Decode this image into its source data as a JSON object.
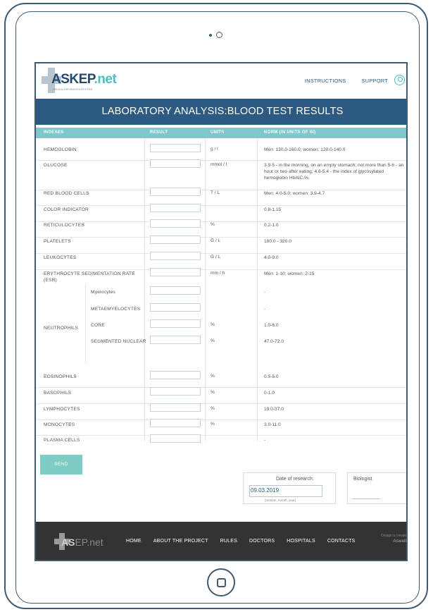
{
  "header": {
    "logo_text": "ASKEP",
    "logo_suffix": ".net",
    "logo_tagline": "MEDICAL INFORMATION SYSTEM",
    "nav": [
      "INSTRUCTIONS",
      "SUPPORT"
    ]
  },
  "page_title": "LABORATORY ANALYSIS:BLOOD TEST RESULTS",
  "table": {
    "headers": [
      "INDEXES",
      "RESULT",
      "UNITS",
      "NORM (IN UNITS OF SI)"
    ],
    "rows": [
      {
        "label": "HEMOGLOBIN",
        "unit": "g / l",
        "norm": "Men: 130.0-160.0; women: 120.0-140.0"
      },
      {
        "label": "GLUCOSE",
        "unit": "mmol / l",
        "norm": "3.9-5 - in the morning, on an empty stomach; not more than 5-6 - an hour or two after eating; 4.6-5.4 - the index of glycosylated hemoglobin HbAIC,%."
      },
      {
        "label": "RED BLOOD CELLS",
        "unit": "T / L",
        "norm": "Men: 4.0-5.0; women: 3.9-4.7"
      },
      {
        "label": "COLOR INDICATOR",
        "unit": "",
        "norm": "0.8-1.15"
      },
      {
        "label": "RETICULOCYTES",
        "unit": "%",
        "norm": "0.2-1.0"
      },
      {
        "label": "PLATELETS",
        "unit": "G / L",
        "norm": "180.0 - 320.0"
      },
      {
        "label": "LEUKOCYTES",
        "unit": "G / L",
        "norm": "4.0-9.0"
      },
      {
        "label": "ERYTHROCYTE SEDIMENTATION RATE (ESR)",
        "unit": "mm / h",
        "norm": "Men: 1-10; women: 2-15"
      }
    ],
    "neutrophils_label": "NEUTROPHILS",
    "neutrophil_rows": [
      {
        "label": "Myelocytes",
        "unit": "",
        "norm": "-"
      },
      {
        "label": "METAEMYELOCYTES",
        "unit": "",
        "norm": "-"
      },
      {
        "label": "CORE",
        "unit": "%",
        "norm": "1.0-6.0"
      },
      {
        "label": "SEGMENTED NUCLEAR",
        "unit": "%",
        "norm": "47.0-72.0"
      }
    ],
    "rows2": [
      {
        "label": "EOSINOPHILS",
        "unit": "%",
        "norm": "0.5-5.0"
      },
      {
        "label": "BASOPHILS",
        "unit": "%",
        "norm": "0-1.0"
      },
      {
        "label": "LYMPHOCYTES",
        "unit": "%",
        "norm": "19.0-37.0"
      },
      {
        "label": "MONOCYTES",
        "unit": "%",
        "norm": "3.0-11.0"
      },
      {
        "label": "PLASMA CELLS",
        "unit": "",
        "norm": "-"
      }
    ]
  },
  "send_label": "SEND",
  "date": {
    "label": "Date of research:",
    "value": "09.03.2019",
    "hint": "(number, month, year)"
  },
  "biologist_label": "Biologist",
  "footer": {
    "logo_text": "AS",
    "logo_suffix": "EP.net",
    "nav": [
      "HOME",
      "ABOUT THE PROJECT",
      "RULES",
      "DOCTORS",
      "HOSPITALS",
      "CONTACTS"
    ],
    "right_top": "Design is create",
    "right_brand": "Aswell"
  }
}
